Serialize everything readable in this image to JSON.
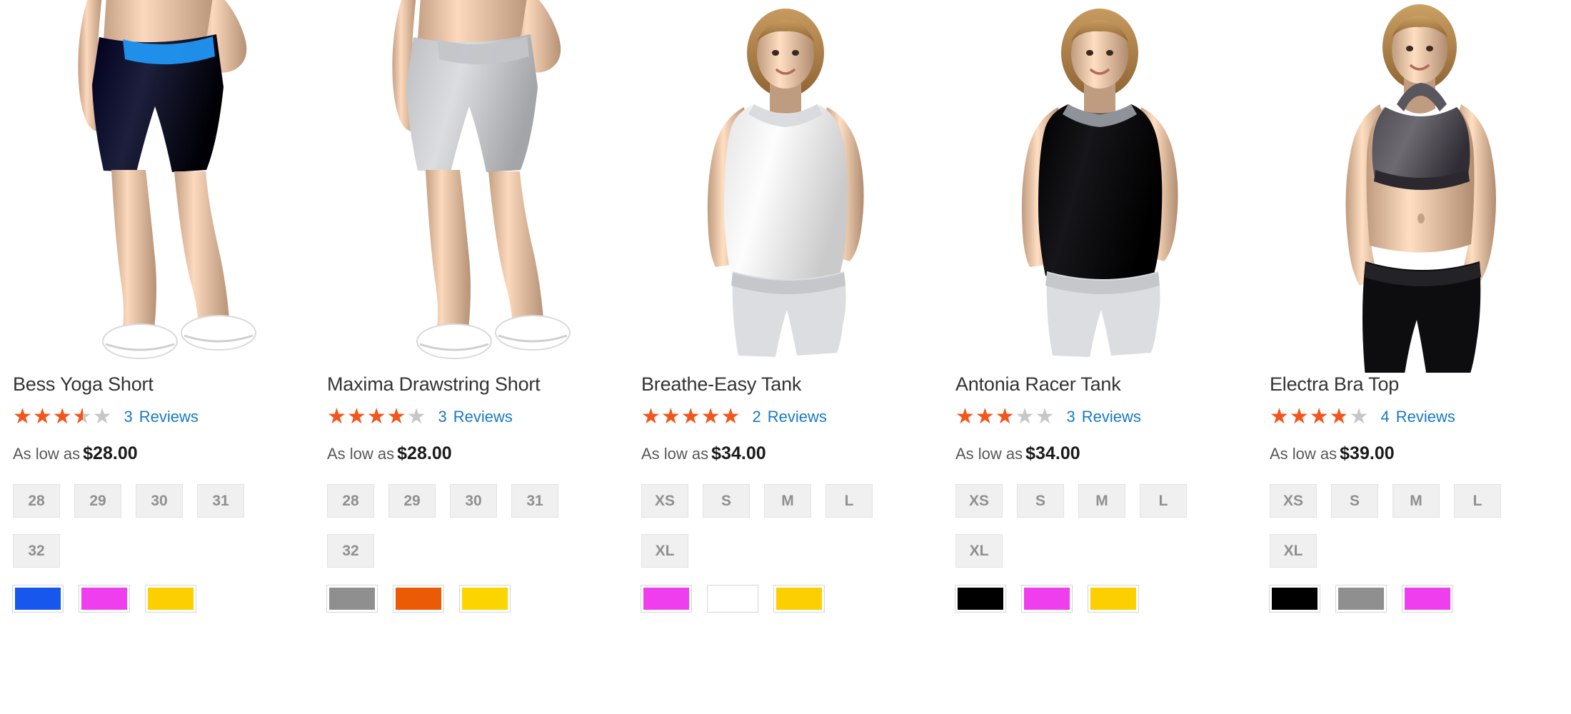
{
  "grid": {
    "columns": 5,
    "accent_color": "#f4551a",
    "link_color": "#1979c3",
    "swatch_border_color": "#d6d6d6",
    "size_swatch_bg": "#f0f0f0",
    "reviews_label": "Reviews",
    "price_prefix": "As low as"
  },
  "products": [
    {
      "name": "Bess Yoga Short",
      "rating_percent": 70,
      "review_count": "3",
      "reviews_label": "Reviews",
      "price_prefix": "As low as",
      "price": "$28.00",
      "sizes": [
        "28",
        "29",
        "30",
        "31",
        "32"
      ],
      "colors": [
        {
          "name": "blue",
          "hex": "#1857ee"
        },
        {
          "name": "purple",
          "hex": "#ee3eee"
        },
        {
          "name": "yellow",
          "hex": "#fcd000"
        }
      ],
      "image": {
        "alt": "Woman wearing navy yoga shorts with blue accent",
        "garment_color": "#1d1f3d",
        "accent_color": "#2196f3",
        "skin_color": "#e8c4a8",
        "type": "shorts-lower-body"
      }
    },
    {
      "name": "Maxima Drawstring Short",
      "rating_percent": 80,
      "review_count": "3",
      "reviews_label": "Reviews",
      "price_prefix": "As low as",
      "price": "$28.00",
      "sizes": [
        "28",
        "29",
        "30",
        "31",
        "32"
      ],
      "colors": [
        {
          "name": "gray",
          "hex": "#8f8f8f"
        },
        {
          "name": "orange",
          "hex": "#eb5a05"
        },
        {
          "name": "yellow",
          "hex": "#fcd500"
        }
      ],
      "image": {
        "alt": "Woman wearing light gray drawstring shorts",
        "garment_color": "#dcdde0",
        "accent_color": "#c3c5c9",
        "skin_color": "#e8c4a8",
        "type": "shorts-lower-body"
      }
    },
    {
      "name": "Breathe-Easy Tank",
      "rating_percent": 100,
      "review_count": "2",
      "reviews_label": "Reviews",
      "price_prefix": "As low as",
      "price": "$34.00",
      "sizes": [
        "XS",
        "S",
        "M",
        "L",
        "XL"
      ],
      "colors": [
        {
          "name": "purple",
          "hex": "#ee3eee"
        },
        {
          "name": "white",
          "hex": "#ffffff"
        },
        {
          "name": "yellow",
          "hex": "#fcd000"
        }
      ],
      "image": {
        "alt": "Smiling woman wearing white tank top and gray shorts",
        "garment_color": "#fdfdfd",
        "accent_color": "#d8d9dc",
        "skin_color": "#e8c4a8",
        "type": "tank-upper-body"
      }
    },
    {
      "name": "Antonia Racer Tank",
      "rating_percent": 60,
      "review_count": "3",
      "reviews_label": "Reviews",
      "price_prefix": "As low as",
      "price": "$34.00",
      "sizes": [
        "XS",
        "S",
        "M",
        "L",
        "XL"
      ],
      "colors": [
        {
          "name": "black",
          "hex": "#000000"
        },
        {
          "name": "purple",
          "hex": "#ee3eee"
        },
        {
          "name": "yellow",
          "hex": "#fcd000"
        }
      ],
      "image": {
        "alt": "Woman wearing black racer tank with gray trim",
        "garment_color": "#16161a",
        "accent_color": "#9a9da4",
        "skin_color": "#e8c4a8",
        "type": "tank-upper-body"
      }
    },
    {
      "name": "Electra Bra Top",
      "rating_percent": 76,
      "review_count": "4",
      "reviews_label": "Reviews",
      "price_prefix": "As low as",
      "price": "$39.00",
      "sizes": [
        "XS",
        "S",
        "M",
        "L",
        "XL"
      ],
      "colors": [
        {
          "name": "black",
          "hex": "#000000"
        },
        {
          "name": "gray",
          "hex": "#8f8f8f"
        },
        {
          "name": "purple",
          "hex": "#ee3eee"
        }
      ],
      "image": {
        "alt": "Woman wearing gray sports bra and black leggings",
        "garment_color": "#6e6a72",
        "accent_color": "#0d0d0f",
        "skin_color": "#e8c4a8",
        "type": "bra-upper-body"
      }
    }
  ]
}
